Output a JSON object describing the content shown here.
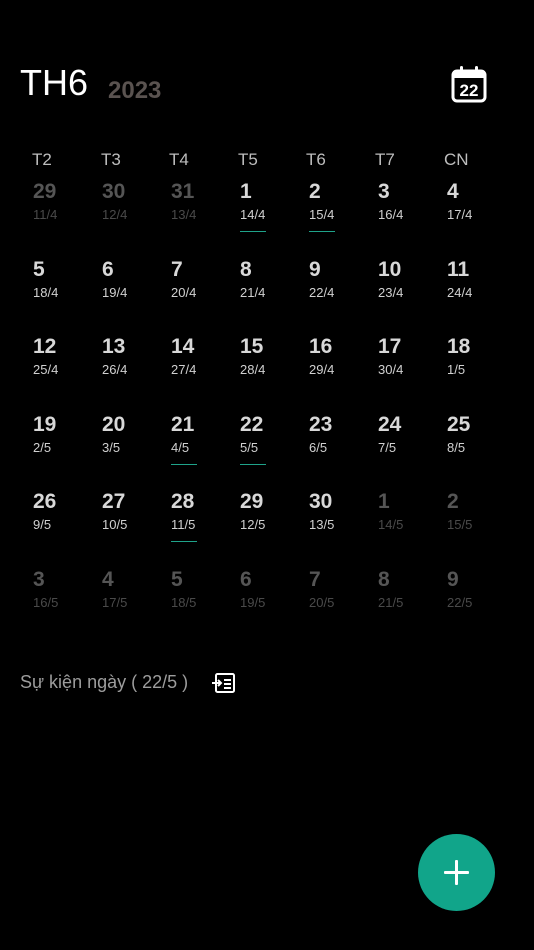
{
  "header": {
    "month": "TH6",
    "year": "2023",
    "today_day": "22"
  },
  "weekdays": [
    "T2",
    "T3",
    "T4",
    "T5",
    "T6",
    "T7",
    "CN"
  ],
  "weeks": [
    [
      {
        "day": "29",
        "lunar": "11/4",
        "current": false,
        "marked": false
      },
      {
        "day": "30",
        "lunar": "12/4",
        "current": false,
        "marked": false
      },
      {
        "day": "31",
        "lunar": "13/4",
        "current": false,
        "marked": false
      },
      {
        "day": "1",
        "lunar": "14/4",
        "current": true,
        "marked": true
      },
      {
        "day": "2",
        "lunar": "15/4",
        "current": true,
        "marked": true
      },
      {
        "day": "3",
        "lunar": "16/4",
        "current": true,
        "marked": false
      },
      {
        "day": "4",
        "lunar": "17/4",
        "current": true,
        "marked": false
      }
    ],
    [
      {
        "day": "5",
        "lunar": "18/4",
        "current": true,
        "marked": false
      },
      {
        "day": "6",
        "lunar": "19/4",
        "current": true,
        "marked": false
      },
      {
        "day": "7",
        "lunar": "20/4",
        "current": true,
        "marked": false
      },
      {
        "day": "8",
        "lunar": "21/4",
        "current": true,
        "marked": false
      },
      {
        "day": "9",
        "lunar": "22/4",
        "current": true,
        "marked": false
      },
      {
        "day": "10",
        "lunar": "23/4",
        "current": true,
        "marked": false
      },
      {
        "day": "11",
        "lunar": "24/4",
        "current": true,
        "marked": false
      }
    ],
    [
      {
        "day": "12",
        "lunar": "25/4",
        "current": true,
        "marked": false
      },
      {
        "day": "13",
        "lunar": "26/4",
        "current": true,
        "marked": false
      },
      {
        "day": "14",
        "lunar": "27/4",
        "current": true,
        "marked": false
      },
      {
        "day": "15",
        "lunar": "28/4",
        "current": true,
        "marked": false
      },
      {
        "day": "16",
        "lunar": "29/4",
        "current": true,
        "marked": false
      },
      {
        "day": "17",
        "lunar": "30/4",
        "current": true,
        "marked": false
      },
      {
        "day": "18",
        "lunar": "1/5",
        "current": true,
        "marked": false
      }
    ],
    [
      {
        "day": "19",
        "lunar": "2/5",
        "current": true,
        "marked": false
      },
      {
        "day": "20",
        "lunar": "3/5",
        "current": true,
        "marked": false
      },
      {
        "day": "21",
        "lunar": "4/5",
        "current": true,
        "marked": true
      },
      {
        "day": "22",
        "lunar": "5/5",
        "current": true,
        "marked": true
      },
      {
        "day": "23",
        "lunar": "6/5",
        "current": true,
        "marked": false
      },
      {
        "day": "24",
        "lunar": "7/5",
        "current": true,
        "marked": false
      },
      {
        "day": "25",
        "lunar": "8/5",
        "current": true,
        "marked": false
      }
    ],
    [
      {
        "day": "26",
        "lunar": "9/5",
        "current": true,
        "marked": false
      },
      {
        "day": "27",
        "lunar": "10/5",
        "current": true,
        "marked": false
      },
      {
        "day": "28",
        "lunar": "11/5",
        "current": true,
        "marked": true
      },
      {
        "day": "29",
        "lunar": "12/5",
        "current": true,
        "marked": false
      },
      {
        "day": "30",
        "lunar": "13/5",
        "current": true,
        "marked": false
      },
      {
        "day": "1",
        "lunar": "14/5",
        "current": false,
        "marked": false
      },
      {
        "day": "2",
        "lunar": "15/5",
        "current": false,
        "marked": false
      }
    ],
    [
      {
        "day": "3",
        "lunar": "16/5",
        "current": false,
        "marked": false
      },
      {
        "day": "4",
        "lunar": "17/5",
        "current": false,
        "marked": false
      },
      {
        "day": "5",
        "lunar": "18/5",
        "current": false,
        "marked": false
      },
      {
        "day": "6",
        "lunar": "19/5",
        "current": false,
        "marked": false
      },
      {
        "day": "7",
        "lunar": "20/5",
        "current": false,
        "marked": false
      },
      {
        "day": "8",
        "lunar": "21/5",
        "current": false,
        "marked": false
      },
      {
        "day": "9",
        "lunar": "22/5",
        "current": false,
        "marked": false
      }
    ]
  ],
  "events": {
    "label": "Sự kiện ngày ( 22/5 )"
  },
  "icons": {
    "today": "calendar-icon",
    "events": "event-list-icon",
    "add": "plus-icon"
  },
  "colors": {
    "accent": "#11a58a",
    "marker": "#1fa38a",
    "year": "#5a5350",
    "background": "#000000"
  }
}
